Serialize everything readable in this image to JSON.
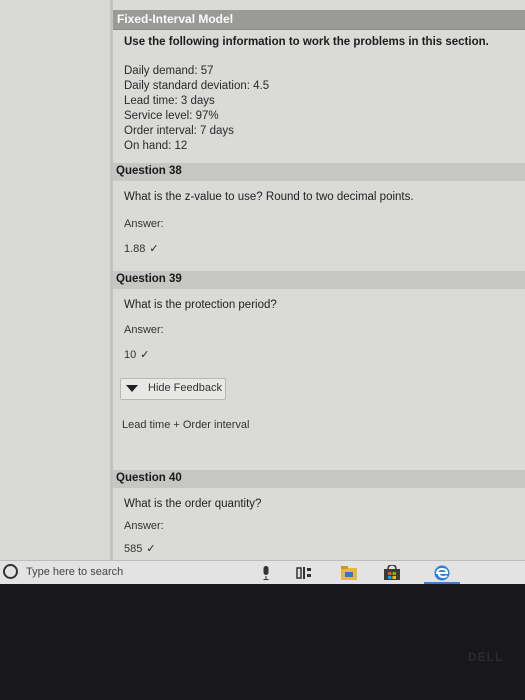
{
  "section": {
    "title": "Fixed-Interval Model",
    "instructions": "Use the following information to work the problems in this section.",
    "info_lines": [
      "Daily demand: 57",
      "Daily standard deviation: 4.5",
      "Lead time: 3 days",
      "Service level: 97%",
      "Order interval: 7 days",
      "On hand: 12"
    ]
  },
  "questions": [
    {
      "header": "Question 38",
      "text": "What is the z-value to use? Round to two decimal points.",
      "answer_label": "Answer:",
      "answer_value": "1.88",
      "check": "✓"
    },
    {
      "header": "Question 39",
      "text": "What is the protection period?",
      "answer_label": "Answer:",
      "answer_value": "10",
      "check": "✓",
      "feedback_button": "Hide Feedback",
      "feedback_text": "Lead time + Order interval"
    },
    {
      "header": "Question 40",
      "text": "What is the order quantity?",
      "answer_label": "Answer:",
      "answer_value": "585",
      "check": "✓"
    }
  ],
  "taskbar": {
    "search_placeholder": "Type here to search",
    "icons": [
      "microphone-icon",
      "task-view-icon",
      "file-explorer-icon",
      "store-icon",
      "edge-icon"
    ],
    "accent": "#3a7bd5"
  },
  "device_logo": "DELL"
}
